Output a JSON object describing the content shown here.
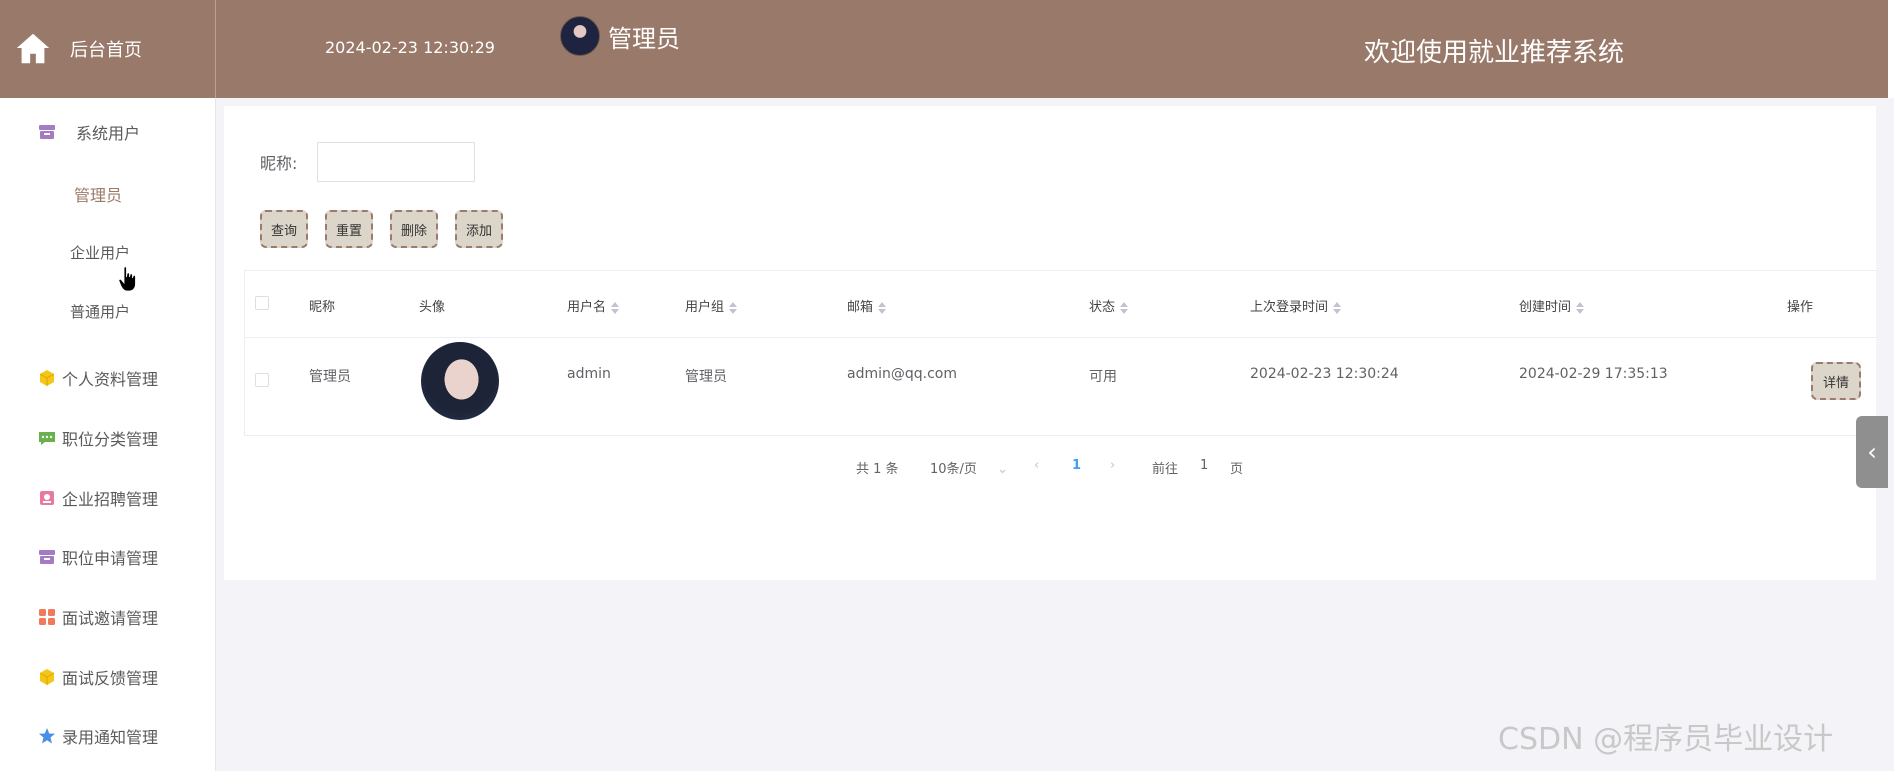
{
  "header": {
    "home_label": "后台首页",
    "datetime": "2024-02-23 12:30:29",
    "user_role": "管理员",
    "system_title": "欢迎使用就业推荐系统"
  },
  "sidebar": {
    "group_system_users": "系统用户",
    "sub_items": [
      "管理员",
      "企业用户",
      "普通用户"
    ],
    "menu": [
      {
        "label": "个人资料管理",
        "icon": "cube-icon",
        "color": "#f5c518"
      },
      {
        "label": "职位分类管理",
        "icon": "chat-icon",
        "color": "#6ab04c"
      },
      {
        "label": "企业招聘管理",
        "icon": "badge-icon",
        "color": "#e87aa0"
      },
      {
        "label": "职位申请管理",
        "icon": "archive-icon",
        "color": "#a57bc4"
      },
      {
        "label": "面试邀请管理",
        "icon": "grid-icon",
        "color": "#f07a5c"
      },
      {
        "label": "面试反馈管理",
        "icon": "cube-icon",
        "color": "#f5c518"
      },
      {
        "label": "录用通知管理",
        "icon": "star-icon",
        "color": "#4a8fe7"
      }
    ]
  },
  "search": {
    "label": "昵称:",
    "placeholder": ""
  },
  "buttons": {
    "query": "查询",
    "reset": "重置",
    "delete": "删除",
    "add": "添加",
    "detail": "详情"
  },
  "table": {
    "columns": [
      "昵称",
      "头像",
      "用户名",
      "用户组",
      "邮箱",
      "状态",
      "上次登录时间",
      "创建时间",
      "操作"
    ],
    "rows": [
      {
        "nickname": "管理员",
        "username": "admin",
        "group": "管理员",
        "email": "admin@qq.com",
        "status": "可用",
        "last_login": "2024-02-23 12:30:24",
        "created": "2024-02-29 17:35:13"
      }
    ]
  },
  "pagination": {
    "total": "共 1 条",
    "page_size": "10条/页",
    "current": "1",
    "goto_prefix": "前往",
    "goto_value": "1",
    "goto_suffix": "页"
  },
  "watermark": "CSDN @程序员毕业设计",
  "colors": {
    "header_bg": "#997a6a",
    "button_bg": "#dcd6ca",
    "button_border": "#9b7b6b",
    "active_page": "#409eff"
  }
}
